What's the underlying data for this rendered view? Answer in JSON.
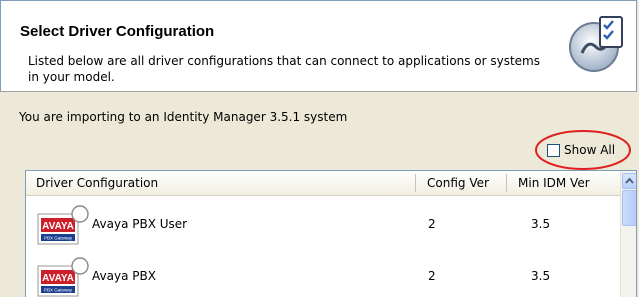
{
  "header": {
    "title": "Select Driver Configuration",
    "description": "Listed below are all driver configurations that can connect to applications or systems in your model.",
    "icon": "config-checklist-icon"
  },
  "import_message": "You are importing to an Identity Manager 3.5.1 system",
  "show_all": {
    "label": "Show All",
    "checked": false
  },
  "table": {
    "columns": [
      "Driver Configuration",
      "Config Ver",
      "Min IDM Ver"
    ],
    "rows": [
      {
        "name": "Avaya PBX User",
        "config_ver": "2",
        "min_idm_ver": "3.5",
        "icon": "avaya-logo-icon"
      },
      {
        "name": "Avaya PBX",
        "config_ver": "2",
        "min_idm_ver": "3.5",
        "icon": "avaya-logo-icon"
      }
    ],
    "logo_text": "AVAYA",
    "logo_subtext": "PBX Gateway"
  },
  "colors": {
    "highlight_ellipse": "#e02020",
    "avaya_red": "#cc1f2a",
    "avaya_blue": "#1b3f8f"
  }
}
